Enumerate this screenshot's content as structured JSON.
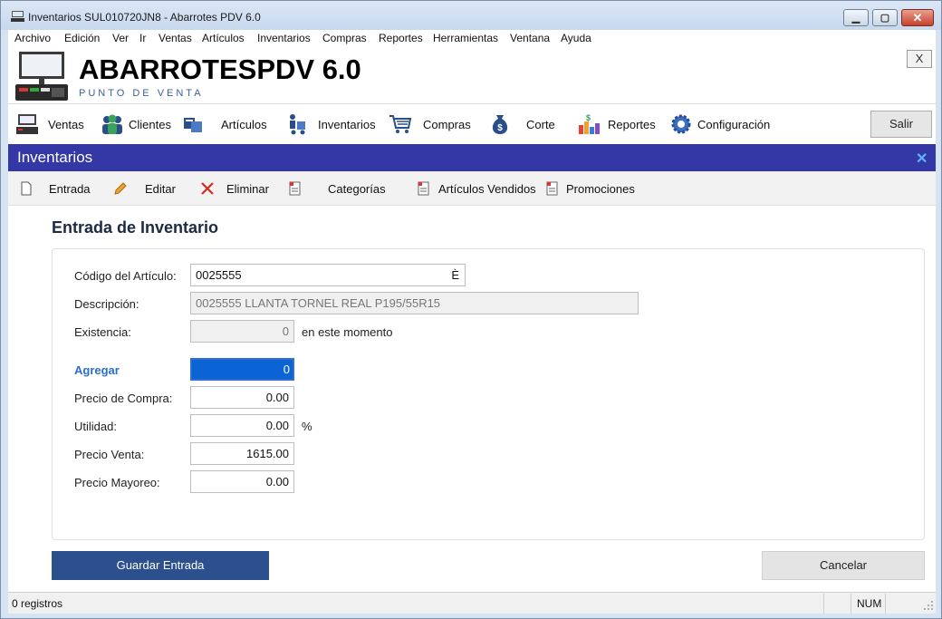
{
  "window": {
    "title": "Inventarios SUL010720JN8 - Abarrotes PDV 6.0",
    "min_label": "▁",
    "max_label": "▢",
    "close_label": "✕"
  },
  "menu": [
    "Archivo",
    "Edición",
    "Ver",
    "Ir",
    "Ventas",
    "Artículos",
    "Inventarios",
    "Compras",
    "Reportes",
    "Herramientas",
    "Ventana",
    "Ayuda"
  ],
  "header": {
    "brand": "ABARROTESPDV 6.0",
    "subtitle": "PUNTO DE VENTA",
    "close_label": "X"
  },
  "toolbar": {
    "items": [
      {
        "label": "Ventas",
        "icon": "cash-register-icon"
      },
      {
        "label": "Clientes",
        "icon": "people-icon"
      },
      {
        "label": "Artículos",
        "icon": "boxes-icon"
      },
      {
        "label": "Inventarios",
        "icon": "hand-truck-icon"
      },
      {
        "label": "Compras",
        "icon": "shopping-cart-icon"
      },
      {
        "label": "Corte",
        "icon": "money-bag-icon"
      },
      {
        "label": "Reportes",
        "icon": "bar-chart-icon"
      },
      {
        "label": "Configuración",
        "icon": "gear-icon"
      }
    ],
    "exit_label": "Salir"
  },
  "module": {
    "title": "Inventarios",
    "close_label": "✕"
  },
  "subtoolbar": {
    "items": [
      {
        "label": "Entrada",
        "icon": "document-icon"
      },
      {
        "label": "Editar",
        "icon": "pencil-icon"
      },
      {
        "label": "Eliminar",
        "icon": "red-x-icon"
      },
      {
        "label": "Categorías",
        "icon": "report-icon"
      },
      {
        "label": "Artículos Vendidos",
        "icon": "report-icon"
      },
      {
        "label": "Promociones",
        "icon": "report-icon"
      }
    ]
  },
  "form": {
    "title": "Entrada de Inventario",
    "codigo": {
      "label": "Código del Artículo:",
      "value": "0025555",
      "lookup_glyph": "È"
    },
    "descripcion": {
      "label": "Descripción:",
      "value": "0025555 LLANTA TORNEL REAL P195/55R15"
    },
    "existencia": {
      "label": "Existencia:",
      "value": "0",
      "suffix": "en este momento"
    },
    "agregar": {
      "label": "Agregar",
      "value": "0"
    },
    "precio_compra": {
      "label": "Precio de Compra:",
      "value": "0.00"
    },
    "utilidad": {
      "label": "Utilidad:",
      "value": "0.00",
      "suffix": "%"
    },
    "precio_venta": {
      "label": "Precio Venta:",
      "value": "1615.00"
    },
    "precio_mayoreo": {
      "label": "Precio Mayoreo:",
      "value": "0.00"
    }
  },
  "actions": {
    "save_label": "Guardar Entrada",
    "cancel_label": "Cancelar"
  },
  "status": {
    "records": "0 registros",
    "num": "NUM"
  }
}
